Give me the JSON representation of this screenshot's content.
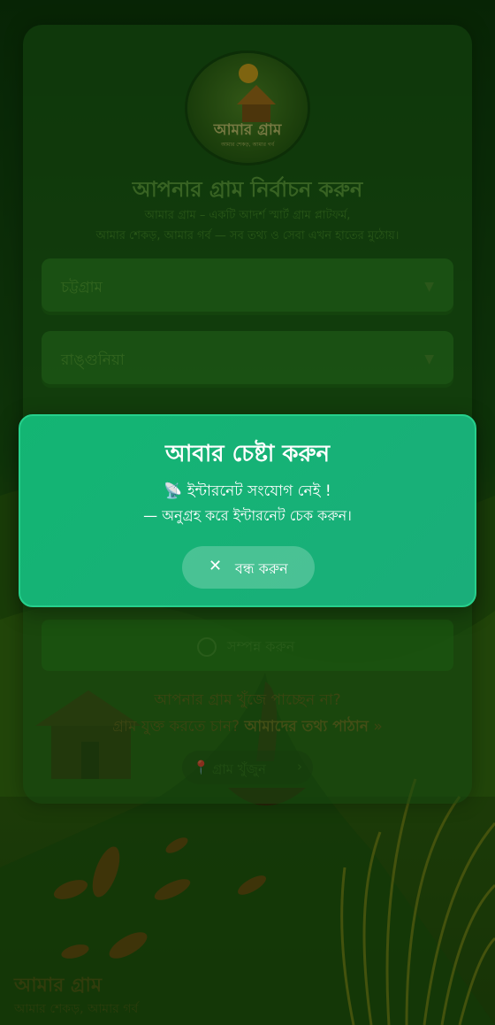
{
  "background": {
    "description_colors": {
      "sky": "#1b4a12",
      "fields": "#4f7a14",
      "grass": "#7a8a16"
    }
  },
  "card": {
    "logo_text": "আমার গ্রাম",
    "logo_subtitle": "আমার শেকড়, আমার গর্ব",
    "title": "আপনার গ্রাম নির্বাচন করুন",
    "subtitle_line1": "আমার গ্রাম – একটি আদর্শ স্মার্ট গ্রাম প্লাটফর্ম,",
    "subtitle_line2": "আমার শেকড়, আমার গর্ব — সব তথ্য ও সেবা এখন হাতের মুঠোয়।",
    "select_district": "চট্টগ্রাম",
    "select_upazila": "রাঙ্গুনিয়া",
    "chevron": "▼",
    "submit_label": "সম্পন্ন করুন",
    "help_line1": "আপনার গ্রাম খুঁজে পাচ্ছেন না?",
    "help_line2": "গ্রাম যুক্ত করতে চান?",
    "help_link": "আমাদের তথ্য পাঠান",
    "help_arrow": "»",
    "find_button": "গ্রাম খুঁজুন",
    "find_pin": "📍",
    "find_arrow": "›"
  },
  "modal": {
    "title": "আবার চেষ্টা করুন",
    "message_line1": "📡 ইন্টারনেট সংযোগ নেই !",
    "message_line2": "— অনুগ্রহ করে ইন্টারনেট চেক করুন।",
    "close_icon": "✕",
    "close_label": "বন্ধ করুন"
  },
  "footer": {
    "brand": "আমার গ্রাম",
    "brand_subtitle": "আমার শেকড়, আমার গর্ব"
  },
  "colors": {
    "modal_bg": "#13b573",
    "modal_border": "#26d08c",
    "modal_text": "#ffffff",
    "card_bg": "#286e1e"
  }
}
